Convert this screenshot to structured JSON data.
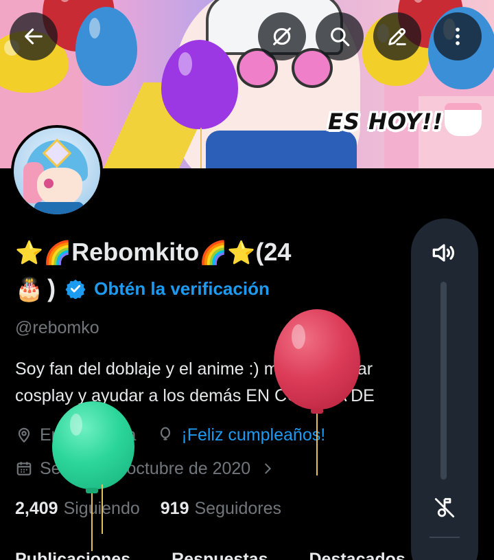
{
  "banner": {
    "caption": "ES HOY!!"
  },
  "header": {
    "back_icon": "arrow-left-icon",
    "grok_icon": "grok-icon",
    "search_icon": "search-icon",
    "edit_icon": "edit-icon",
    "more_icon": "more-vertical-icon"
  },
  "profile": {
    "name_text": "Rebomkito",
    "name_suffix": "(24",
    "name_close": ")",
    "verify_label": "Obtén la verificación",
    "handle": "@rebomko",
    "bio_line1": "Soy fan del doblaje y el anime :) me gusta el ar",
    "bio_line2": "cosplay y ayudar a los demás EN CONTRA DE",
    "location": "En el manga",
    "birthday": "¡Feliz cumpleaños!",
    "joined": "Se unió en octubre de 2020",
    "following_count": "2,409",
    "following_label": "Siguiendo",
    "followers_count": "919",
    "followers_label": "Seguidores"
  },
  "tabs": [
    "Publicaciones",
    "Respuestas",
    "Destacados"
  ],
  "volume_panel": {
    "level": 0,
    "speaker_icon": "speaker-icon",
    "mute_icon": "music-off-icon"
  },
  "colors": {
    "accent": "#1d9bf0",
    "muted_text": "#71767b",
    "primary_text": "#e7e9ea",
    "background": "#000000",
    "panel": "#1e2732"
  }
}
